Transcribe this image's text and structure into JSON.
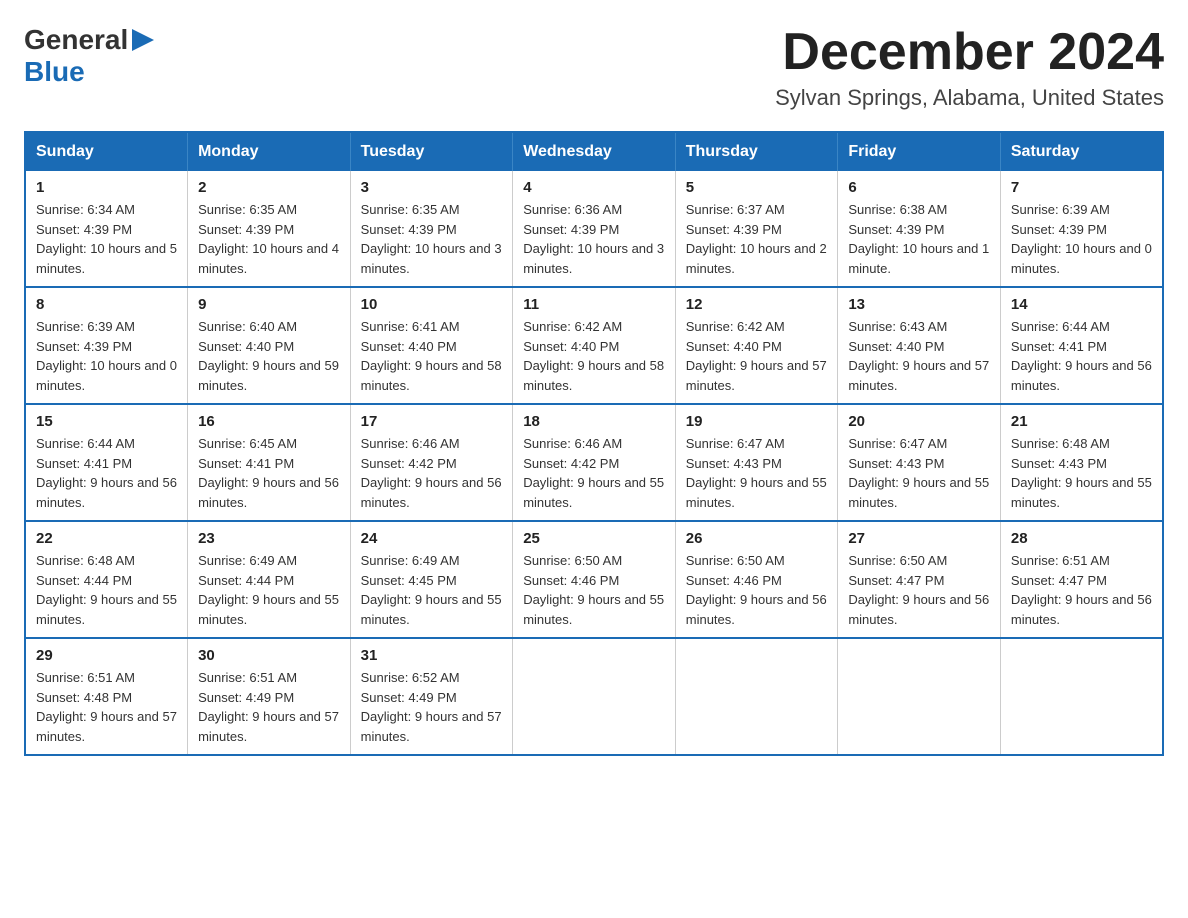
{
  "logo": {
    "general": "General",
    "blue": "Blue"
  },
  "title": {
    "month_year": "December 2024",
    "location": "Sylvan Springs, Alabama, United States"
  },
  "weekdays": [
    "Sunday",
    "Monday",
    "Tuesday",
    "Wednesday",
    "Thursday",
    "Friday",
    "Saturday"
  ],
  "weeks": [
    [
      {
        "day": "1",
        "sunrise": "6:34 AM",
        "sunset": "4:39 PM",
        "daylight": "10 hours and 5 minutes."
      },
      {
        "day": "2",
        "sunrise": "6:35 AM",
        "sunset": "4:39 PM",
        "daylight": "10 hours and 4 minutes."
      },
      {
        "day": "3",
        "sunrise": "6:35 AM",
        "sunset": "4:39 PM",
        "daylight": "10 hours and 3 minutes."
      },
      {
        "day": "4",
        "sunrise": "6:36 AM",
        "sunset": "4:39 PM",
        "daylight": "10 hours and 3 minutes."
      },
      {
        "day": "5",
        "sunrise": "6:37 AM",
        "sunset": "4:39 PM",
        "daylight": "10 hours and 2 minutes."
      },
      {
        "day": "6",
        "sunrise": "6:38 AM",
        "sunset": "4:39 PM",
        "daylight": "10 hours and 1 minute."
      },
      {
        "day": "7",
        "sunrise": "6:39 AM",
        "sunset": "4:39 PM",
        "daylight": "10 hours and 0 minutes."
      }
    ],
    [
      {
        "day": "8",
        "sunrise": "6:39 AM",
        "sunset": "4:39 PM",
        "daylight": "10 hours and 0 minutes."
      },
      {
        "day": "9",
        "sunrise": "6:40 AM",
        "sunset": "4:40 PM",
        "daylight": "9 hours and 59 minutes."
      },
      {
        "day": "10",
        "sunrise": "6:41 AM",
        "sunset": "4:40 PM",
        "daylight": "9 hours and 58 minutes."
      },
      {
        "day": "11",
        "sunrise": "6:42 AM",
        "sunset": "4:40 PM",
        "daylight": "9 hours and 58 minutes."
      },
      {
        "day": "12",
        "sunrise": "6:42 AM",
        "sunset": "4:40 PM",
        "daylight": "9 hours and 57 minutes."
      },
      {
        "day": "13",
        "sunrise": "6:43 AM",
        "sunset": "4:40 PM",
        "daylight": "9 hours and 57 minutes."
      },
      {
        "day": "14",
        "sunrise": "6:44 AM",
        "sunset": "4:41 PM",
        "daylight": "9 hours and 56 minutes."
      }
    ],
    [
      {
        "day": "15",
        "sunrise": "6:44 AM",
        "sunset": "4:41 PM",
        "daylight": "9 hours and 56 minutes."
      },
      {
        "day": "16",
        "sunrise": "6:45 AM",
        "sunset": "4:41 PM",
        "daylight": "9 hours and 56 minutes."
      },
      {
        "day": "17",
        "sunrise": "6:46 AM",
        "sunset": "4:42 PM",
        "daylight": "9 hours and 56 minutes."
      },
      {
        "day": "18",
        "sunrise": "6:46 AM",
        "sunset": "4:42 PM",
        "daylight": "9 hours and 55 minutes."
      },
      {
        "day": "19",
        "sunrise": "6:47 AM",
        "sunset": "4:43 PM",
        "daylight": "9 hours and 55 minutes."
      },
      {
        "day": "20",
        "sunrise": "6:47 AM",
        "sunset": "4:43 PM",
        "daylight": "9 hours and 55 minutes."
      },
      {
        "day": "21",
        "sunrise": "6:48 AM",
        "sunset": "4:43 PM",
        "daylight": "9 hours and 55 minutes."
      }
    ],
    [
      {
        "day": "22",
        "sunrise": "6:48 AM",
        "sunset": "4:44 PM",
        "daylight": "9 hours and 55 minutes."
      },
      {
        "day": "23",
        "sunrise": "6:49 AM",
        "sunset": "4:44 PM",
        "daylight": "9 hours and 55 minutes."
      },
      {
        "day": "24",
        "sunrise": "6:49 AM",
        "sunset": "4:45 PM",
        "daylight": "9 hours and 55 minutes."
      },
      {
        "day": "25",
        "sunrise": "6:50 AM",
        "sunset": "4:46 PM",
        "daylight": "9 hours and 55 minutes."
      },
      {
        "day": "26",
        "sunrise": "6:50 AM",
        "sunset": "4:46 PM",
        "daylight": "9 hours and 56 minutes."
      },
      {
        "day": "27",
        "sunrise": "6:50 AM",
        "sunset": "4:47 PM",
        "daylight": "9 hours and 56 minutes."
      },
      {
        "day": "28",
        "sunrise": "6:51 AM",
        "sunset": "4:47 PM",
        "daylight": "9 hours and 56 minutes."
      }
    ],
    [
      {
        "day": "29",
        "sunrise": "6:51 AM",
        "sunset": "4:48 PM",
        "daylight": "9 hours and 57 minutes."
      },
      {
        "day": "30",
        "sunrise": "6:51 AM",
        "sunset": "4:49 PM",
        "daylight": "9 hours and 57 minutes."
      },
      {
        "day": "31",
        "sunrise": "6:52 AM",
        "sunset": "4:49 PM",
        "daylight": "9 hours and 57 minutes."
      },
      null,
      null,
      null,
      null
    ]
  ]
}
